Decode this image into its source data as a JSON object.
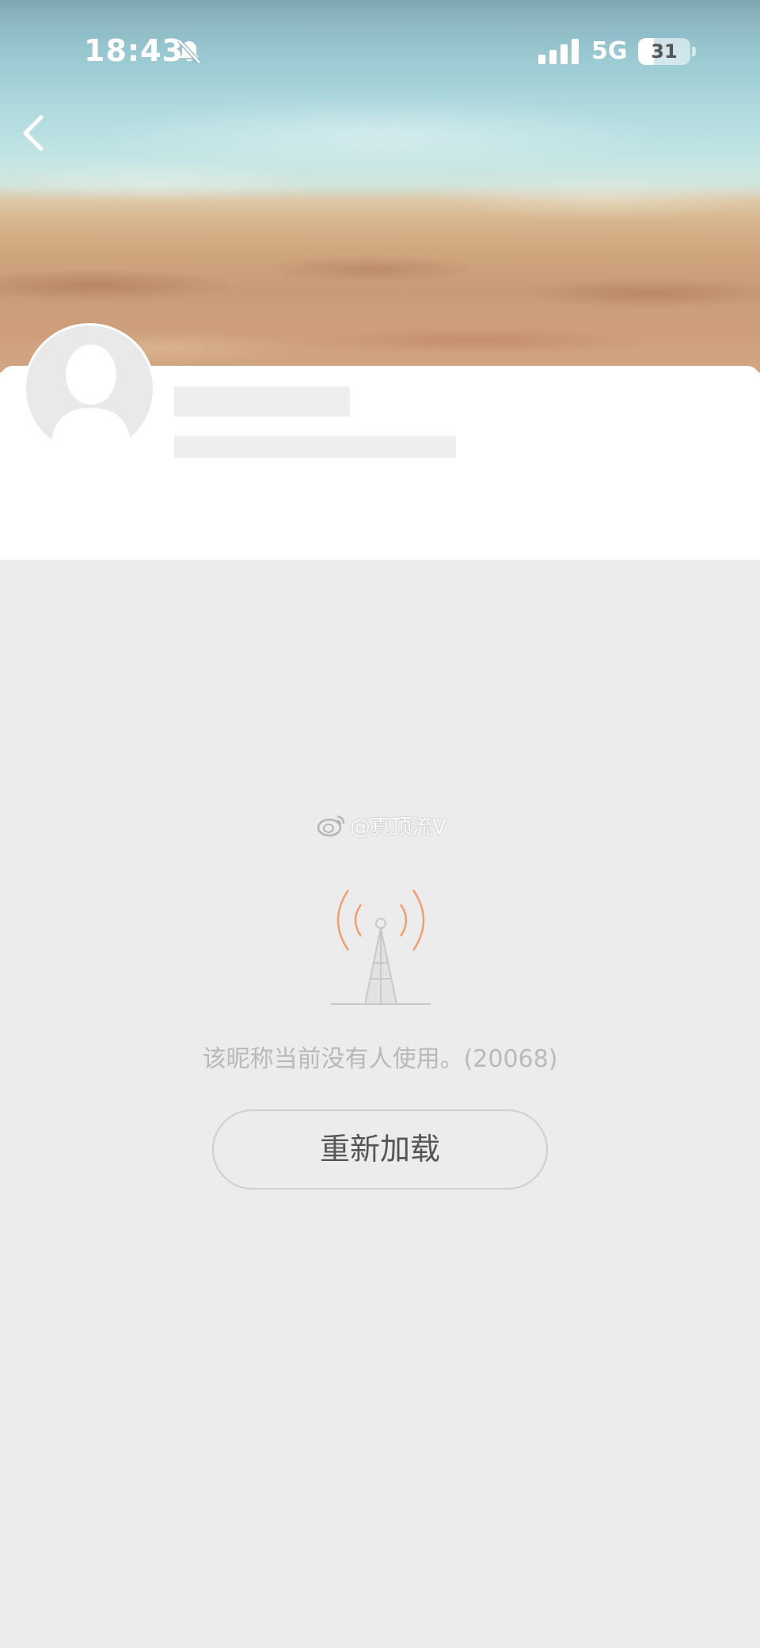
{
  "status_bar": {
    "time": "18:43",
    "network": "5G",
    "battery_level": 31,
    "battery_text": "31"
  },
  "icons": {
    "mute": "bell-slash-icon",
    "signal": "cellular-signal-icon",
    "back": "chevron-left-icon",
    "avatar": "default-avatar-icon",
    "tower": "signal-tower-icon",
    "weibo": "weibo-logo-icon"
  },
  "watermark": {
    "text": "@真顶流V"
  },
  "error": {
    "message": "该昵称当前没有人使用。(20068)",
    "reload_label": "重新加载"
  },
  "colors": {
    "background": "#ececec",
    "tower_waves": "#f0a070",
    "tower_lines": "#c8c8c8",
    "message": "#b9b9b9"
  }
}
